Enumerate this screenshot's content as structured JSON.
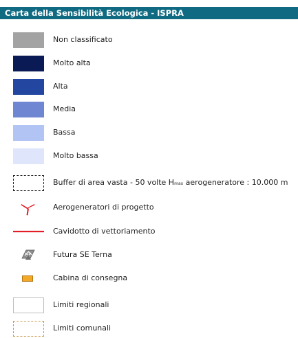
{
  "legend": {
    "title": "Carta della Sensibilità Ecologica - ISPRA",
    "classes": [
      {
        "label": "Non classificato",
        "color": "#a3a3a3"
      },
      {
        "label": "Molto alta",
        "color": "#0a1a55"
      },
      {
        "label": "Alta",
        "color": "#2347a0"
      },
      {
        "label": "Media",
        "color": "#6f87d2"
      },
      {
        "label": "Bassa",
        "color": "#b2c4f3"
      },
      {
        "label": "Molto bassa",
        "color": "#dfe6fc"
      }
    ],
    "buffer": {
      "label_prefix": "Buffer di area vasta - 50 volte H",
      "label_sub": "max",
      "label_suffix": " aerogeneratore : 10.000 m"
    },
    "turbines": {
      "label": "Aerogeneratori di progetto",
      "color": "#e11d25",
      "icon": "turbine-icon"
    },
    "cable": {
      "label": "Cavidotto di vettoriamento",
      "color": "#e11d25"
    },
    "substation": {
      "label": "Futura SE Terna",
      "color": "#8e8e8e",
      "icon": "substation-icon"
    },
    "cabin": {
      "label": "Cabina di consegna",
      "color": "#f3a928"
    },
    "regional": {
      "label": "Limiti regionali",
      "color": "#bdbdbd"
    },
    "municipal": {
      "label": "Limiti comunali",
      "color": "#c79a4c"
    }
  }
}
